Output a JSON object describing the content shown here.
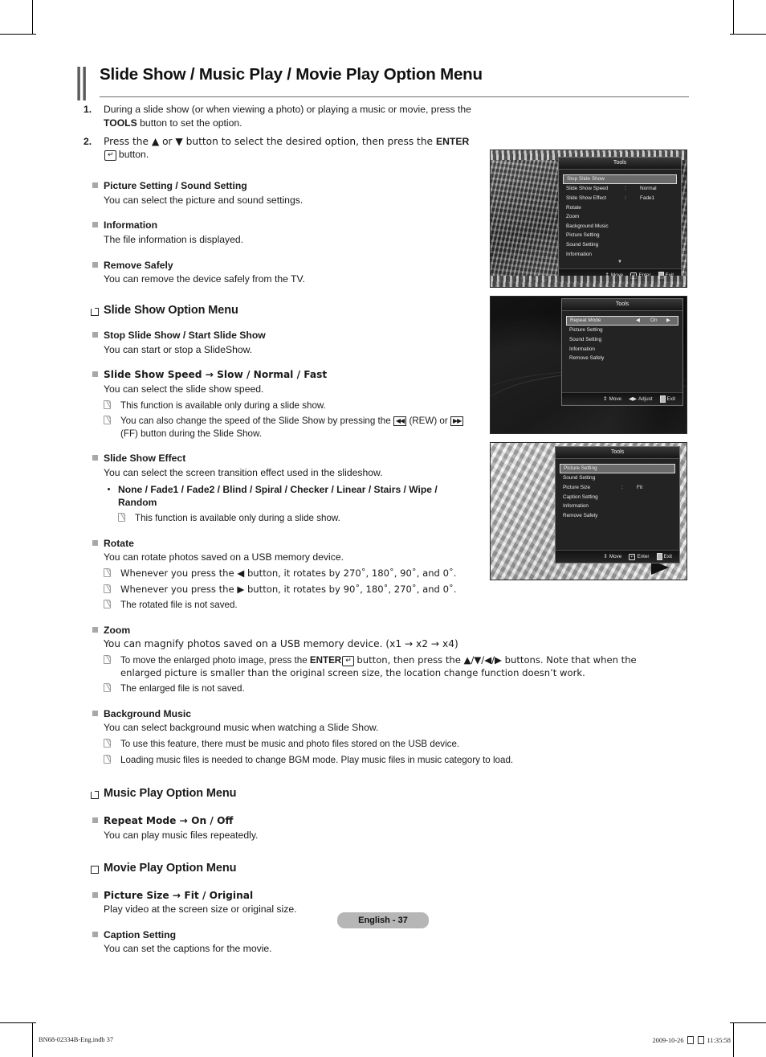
{
  "document": {
    "title": "Slide Show / Music Play / Movie Play Option Menu",
    "page_badge": "English - 37",
    "footer_left": "BN68-02334B-Eng.indb   37",
    "footer_date": "2009-10-26",
    "footer_time": "11:35:58"
  },
  "steps": [
    {
      "num": "1.",
      "parts": [
        "During a slide show (or when viewing a photo) or playing a music or movie, press the ",
        "TOOLS",
        " button to set the option."
      ]
    },
    {
      "num": "2.",
      "parts": [
        "Press the ▲ or ▼ button to select the desired option, then press the ",
        "ENTER",
        " button."
      ]
    }
  ],
  "intro_items": [
    {
      "term": "Picture Setting / Sound Setting",
      "desc": "You can select the picture and sound settings."
    },
    {
      "term": "Information",
      "desc": "The file information is displayed."
    },
    {
      "term": "Remove Safely",
      "desc": "You can remove the device safely from the TV."
    }
  ],
  "sections": [
    {
      "heading": "Slide Show Option Menu"
    },
    {
      "heading": "Music Play Option Menu"
    },
    {
      "heading": "Movie Play Option Menu"
    }
  ],
  "slideshow_items": {
    "stop": {
      "term": "Stop Slide Show / Start Slide Show",
      "desc": "You can start or stop a SlideShow."
    },
    "speed": {
      "term": "Slide Show Speed → Slow / Normal / Fast",
      "desc": "You can select the slide show speed.",
      "note1": "This function is available only during a slide show.",
      "note2_a": "You can also change the speed of the Slide Show by pressing the ",
      "note2_rew": "◀◀",
      "note2_b": " (REW) or ",
      "note2_ff": "▶▶",
      "note2_c": " (FF) button during the Slide Show."
    },
    "effect": {
      "term": "Slide Show Effect",
      "desc": "You can select the screen transition effect used in the slideshow.",
      "options": "None / Fade1 / Fade2 / Blind / Spiral / Checker / Linear / Stairs / Wipe / Random",
      "note1": "This function is available only during a slide show."
    },
    "rotate": {
      "term": "Rotate",
      "desc": "You can rotate photos saved on a USB memory device.",
      "note1": "Whenever you press the ◀ button, it rotates by 270˚, 180˚, 90˚, and 0˚.",
      "note2": "Whenever you press the ▶ button, it rotates by 90˚, 180˚, 270˚, and 0˚.",
      "note3": "The rotated file is not saved."
    },
    "zoom": {
      "term": "Zoom",
      "desc": "You can magnify photos saved on a USB memory device. (x1 → x2 → x4)",
      "note1_a": "To move the enlarged photo image, press the ",
      "note1_enter": "ENTER",
      "note1_b": " button, then press the ▲/▼/◀/▶ buttons. Note that when the enlarged picture is smaller than the original screen size, the location change function doesn’t work.",
      "note2": "The enlarged file is not saved."
    },
    "bgm": {
      "term": "Background Music",
      "desc": "You can select background music when watching a Slide Show.",
      "note1": "To use this feature, there must be music and photo files stored on the USB device.",
      "note2": "Loading music files is needed to change BGM mode. Play music files in music category to load."
    }
  },
  "music_items": {
    "repeat": {
      "term": "Repeat Mode → On / Off",
      "desc": "You can play music files repeatedly."
    }
  },
  "movie_items": {
    "picture_size": {
      "term": "Picture Size → Fit / Original",
      "desc": "Play video at the screen size or original size."
    },
    "caption": {
      "term": "Caption Setting",
      "desc": "You can set the captions for the movie."
    }
  },
  "osd_screens": [
    {
      "title": "Tools",
      "rows": [
        {
          "label": "Stop Slide Show",
          "selected": true
        },
        {
          "label": "Slide Show Speed",
          "colon": ":",
          "value": "Normal"
        },
        {
          "label": "Slide Show Effect",
          "colon": ":",
          "value": "Fade1"
        },
        {
          "label": "Rotate"
        },
        {
          "label": "Zoom"
        },
        {
          "label": "Background Music"
        },
        {
          "label": "Picture Setting"
        },
        {
          "label": "Sound Setting"
        },
        {
          "label": "Information"
        }
      ],
      "scroll_indicator": "▼",
      "footer": [
        {
          "glyph": "↕",
          "label": "Move"
        },
        {
          "glyph": "enter",
          "label": "Enter"
        },
        {
          "glyph": "exit",
          "label": "Exit"
        }
      ]
    },
    {
      "title": "Tools",
      "rows": [
        {
          "label": "Repeat Mode",
          "selected": true,
          "left_arrow": "◀",
          "value": "On",
          "right_arrow": "▶"
        },
        {
          "label": "Picture Setting"
        },
        {
          "label": "Sound Setting"
        },
        {
          "label": "Information"
        },
        {
          "label": "Remove Safely"
        }
      ],
      "footer": [
        {
          "glyph": "↕",
          "label": "Move"
        },
        {
          "glyph": "◀▶",
          "label": "Adjust"
        },
        {
          "glyph": "exit",
          "label": "Exit"
        }
      ]
    },
    {
      "title": "Tools",
      "rows": [
        {
          "label": "Picture Setting",
          "selected": true
        },
        {
          "label": "Sound Setting"
        },
        {
          "label": "Picture Size",
          "colon": ":",
          "value": "Fit"
        },
        {
          "label": "Caption Setting"
        },
        {
          "label": "Information"
        },
        {
          "label": "Remove Safely"
        }
      ],
      "footer": [
        {
          "glyph": "↕",
          "label": "Move"
        },
        {
          "glyph": "enter",
          "label": "Enter"
        },
        {
          "glyph": "exit",
          "label": "Exit"
        }
      ]
    }
  ]
}
